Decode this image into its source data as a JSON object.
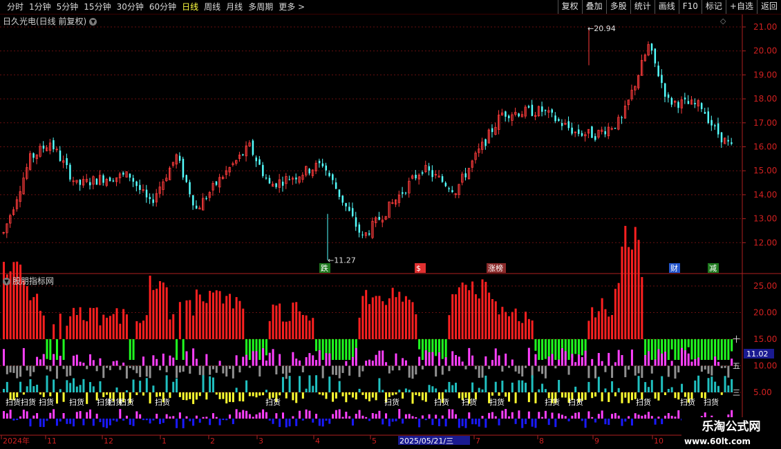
{
  "toolbar": {
    "periods": [
      "分时",
      "1分钟",
      "5分钟",
      "15分钟",
      "30分钟",
      "60分钟",
      "日线",
      "周线",
      "月线",
      "多周期",
      "更多 >"
    ],
    "active_period": "日线",
    "right_buttons": [
      "复权",
      "叠加",
      "多股",
      "统计",
      "画线",
      "F10",
      "标记",
      "+自选",
      "返回"
    ]
  },
  "main_title": "日久光电(日线 前复权)",
  "indicator_title": "股朋指标网",
  "price_axis": [
    "21.00",
    "20.00",
    "19.00",
    "18.00",
    "17.00",
    "16.00",
    "15.00",
    "14.00",
    "13.00",
    "12.00"
  ],
  "indicator_axis": [
    "25.00",
    "20.00",
    "15.00",
    "10.00",
    "5.00"
  ],
  "high_label": "20.94",
  "low_label": "11.27",
  "current_value_tag": "11.02",
  "time_axis": [
    "2024年",
    "11",
    "12",
    "1",
    "2",
    "3",
    "4",
    "5",
    "2025/05/21/三",
    "7",
    "8",
    "9",
    "10"
  ],
  "event_markers": [
    {
      "label": "跌",
      "color": "#1f7a1f"
    },
    {
      "label": "$",
      "color": "#e03030"
    },
    {
      "label": "涨榜",
      "color": "#8a2a2a"
    },
    {
      "label": "财",
      "color": "#2255cc"
    },
    {
      "label": "减",
      "color": "#1f7a1f"
    }
  ],
  "side_markers": [
    "十",
    "五",
    "三"
  ],
  "scan_label": "扫货",
  "watermark": {
    "title": "乐淘公式网",
    "url": "www.60lt.com"
  },
  "colors": {
    "up": "#ff3c3c",
    "down": "#54ffff",
    "red_bar": "#ff2020",
    "green_bar": "#20ff20",
    "magenta": "#ff40ff",
    "cyan": "#20c0c0",
    "gray": "#909090",
    "yellow": "#ffff30",
    "blue": "#1a1aff"
  }
}
